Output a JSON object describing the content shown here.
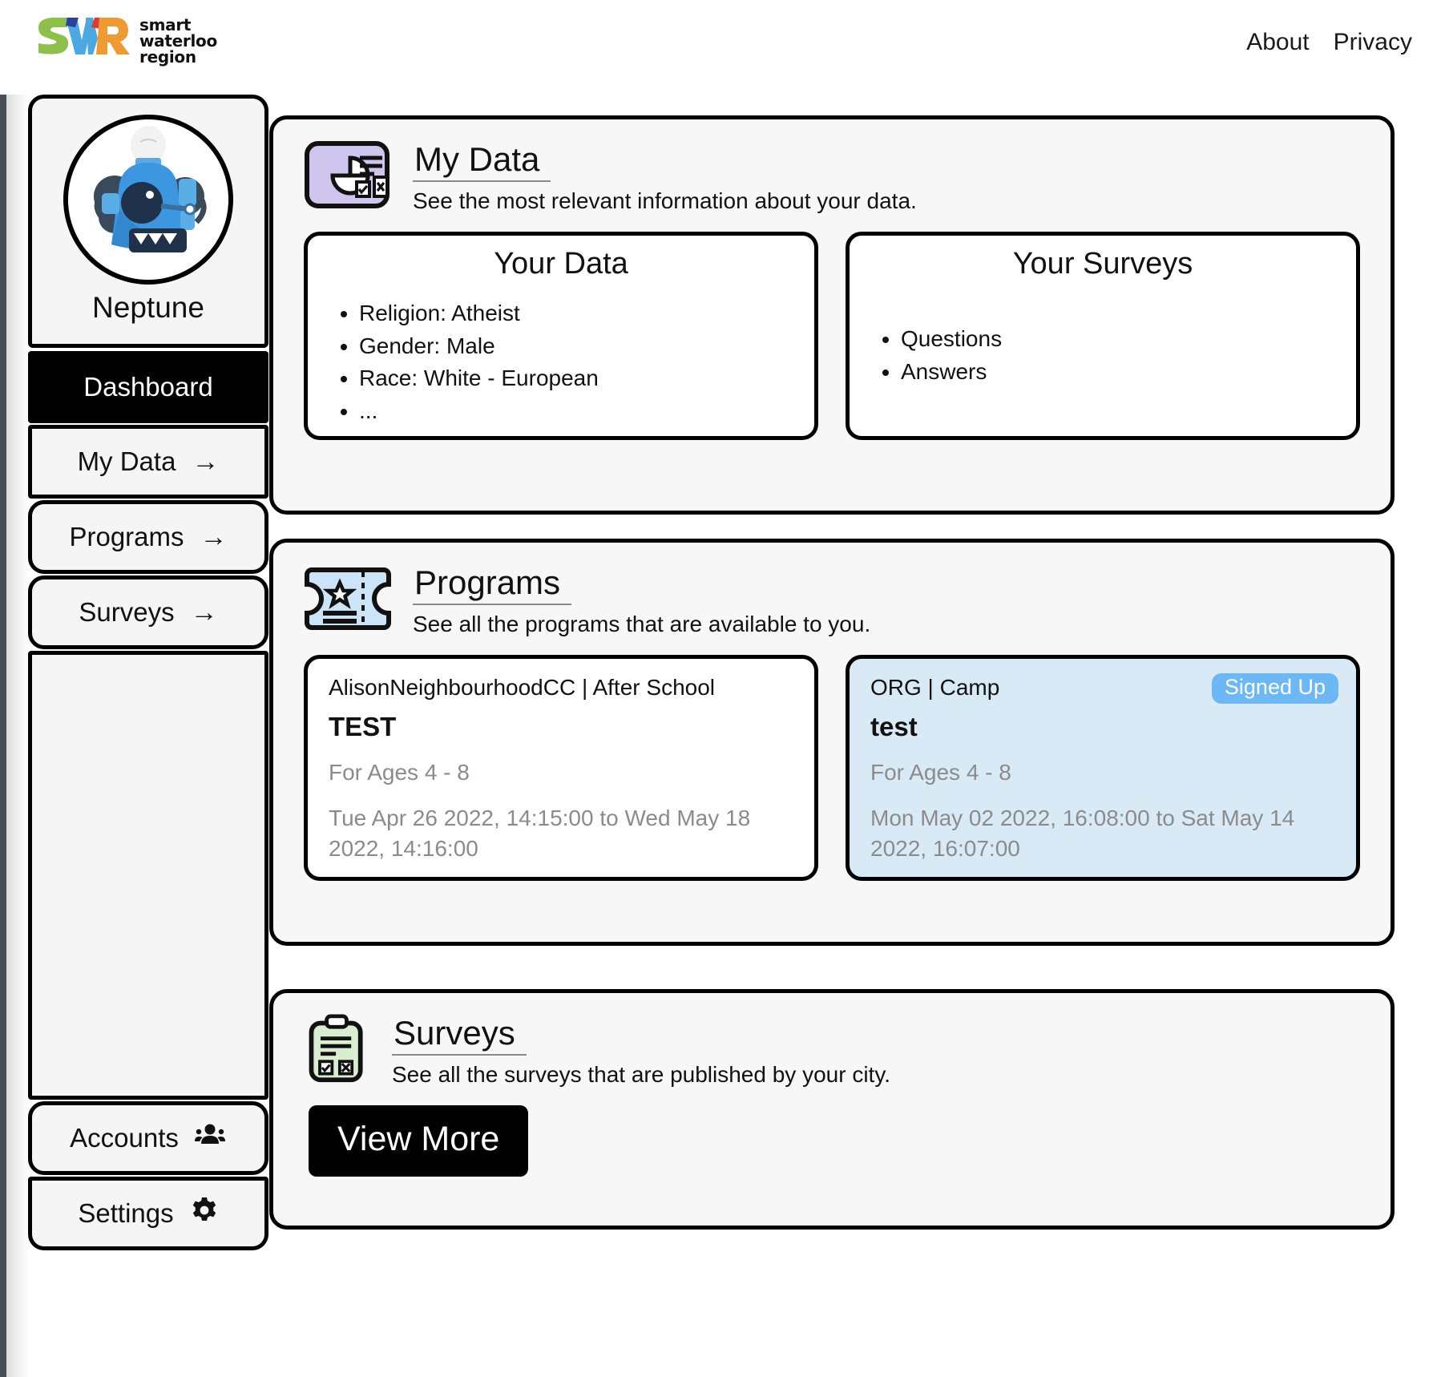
{
  "header": {
    "logo": {
      "mark": "swr-logo",
      "words": [
        "smart",
        "waterloo",
        "region"
      ],
      "colors": {
        "s": "#8cc04a",
        "w": "#4aa9e0",
        "r": "#ef9b33",
        "accent_blue": "#2b3f9e",
        "accent_red": "#e23b2e"
      }
    },
    "nav": [
      {
        "label": "About",
        "name": "nav-link-about"
      },
      {
        "label": "Privacy",
        "name": "nav-link-privacy"
      }
    ]
  },
  "sidebar": {
    "profile": {
      "username": "Neptune",
      "avatar_icon": "robot-avatar"
    },
    "items": [
      {
        "label": "Dashboard",
        "active": true,
        "icon": ""
      },
      {
        "label": "My Data",
        "active": false,
        "icon": "arrow-right-icon"
      },
      {
        "label": "Programs",
        "active": false,
        "icon": "arrow-right-icon"
      },
      {
        "label": "Surveys",
        "active": false,
        "icon": "arrow-right-icon"
      }
    ],
    "bottom_items": [
      {
        "label": "Accounts",
        "icon": "people-icon"
      },
      {
        "label": "Settings",
        "icon": "gear-icon"
      }
    ]
  },
  "sections": {
    "my_data": {
      "title": "My Data",
      "subtitle": "See the most relevant information about your data.",
      "icon": "data-report-icon",
      "icon_color": "#cfc6f0",
      "cards": [
        {
          "title": "Your Data",
          "items": [
            "Religion: Atheist",
            "Gender: Male",
            "Race: White - European",
            "..."
          ]
        },
        {
          "title": "Your Surveys",
          "items": [
            "Questions",
            "Answers"
          ]
        }
      ]
    },
    "programs": {
      "title": "Programs",
      "subtitle": "See all the programs that are available to you.",
      "icon": "ticket-star-icon",
      "icon_color": "#cbe4f7",
      "cards": [
        {
          "org": "AlisonNeighbourhoodCC | After School",
          "name": "TEST",
          "ages": "For Ages 4 - 8",
          "dates": "Tue Apr 26 2022, 14:15:00 to Wed May 18 2022, 14:16:00",
          "badge": "",
          "signed_up": false
        },
        {
          "org": "ORG | Camp",
          "name": "test",
          "ages": "For Ages 4 - 8",
          "dates": "Mon May 02 2022, 16:08:00 to Sat May 14 2022, 16:07:00",
          "badge": "Signed Up",
          "signed_up": true
        }
      ]
    },
    "surveys": {
      "title": "Surveys",
      "subtitle": "See all the surveys that are published by your city.",
      "icon": "clipboard-check-icon",
      "icon_color": "#d9edd1",
      "view_more_label": "View More"
    }
  },
  "colors": {
    "accent_badge": "#6cb8f5",
    "signed_card_bg": "#d9eaf7",
    "panel_bg": "#f5f5f5",
    "section_bg": "#f7f7f7",
    "muted_text": "#8b8b8b"
  }
}
